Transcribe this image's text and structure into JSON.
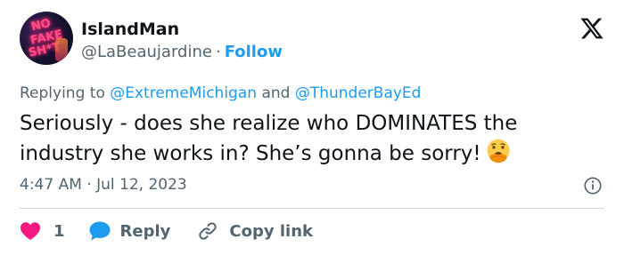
{
  "author": {
    "display_name": "IslandMan",
    "handle": "@LaBeaujardine",
    "separator": "·",
    "follow_label": "Follow",
    "avatar_text": [
      "NO",
      "FAKE",
      "SH*T"
    ]
  },
  "reply_context": {
    "prefix": "Replying to",
    "mention_1": "@ExtremeMichigan",
    "conjunction": "and",
    "mention_2": "@ThunderBayEd"
  },
  "tweet": {
    "text": "Seriously - does she realize who DOMINATES the industry she works in? She’s gonna be sorry!",
    "emoji": "face-with-hand-over-mouth",
    "timestamp": "4:47 AM · Jul 12, 2023"
  },
  "actions": {
    "like_count": "1",
    "reply_label": "Reply",
    "copy_link_label": "Copy link"
  },
  "colors": {
    "accent": "#1d9bf0",
    "like": "#f91880",
    "text_primary": "#0f1419",
    "text_secondary": "#536471",
    "divider": "#cfd9de"
  }
}
